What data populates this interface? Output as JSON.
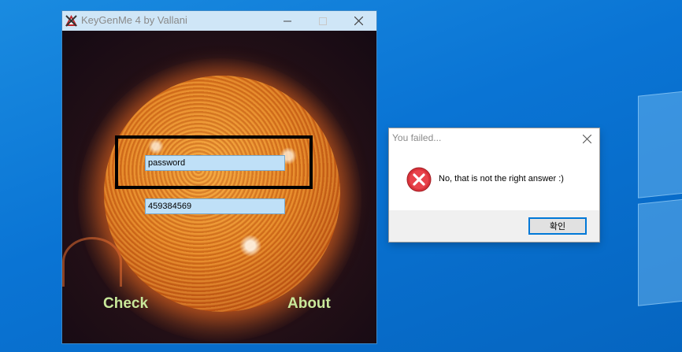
{
  "desktop": {
    "background_color": "#0a74d4"
  },
  "app_window": {
    "title": "KeyGenMe 4 by Vallani",
    "password_value": "password",
    "serial_value": "459384569",
    "check_label": "Check",
    "about_label": "About",
    "accent_button_color": "#c9e89a"
  },
  "dialog": {
    "title": "You failed...",
    "message": "No, that is not the right answer :)",
    "ok_label": "확인",
    "icon": "error-icon"
  }
}
